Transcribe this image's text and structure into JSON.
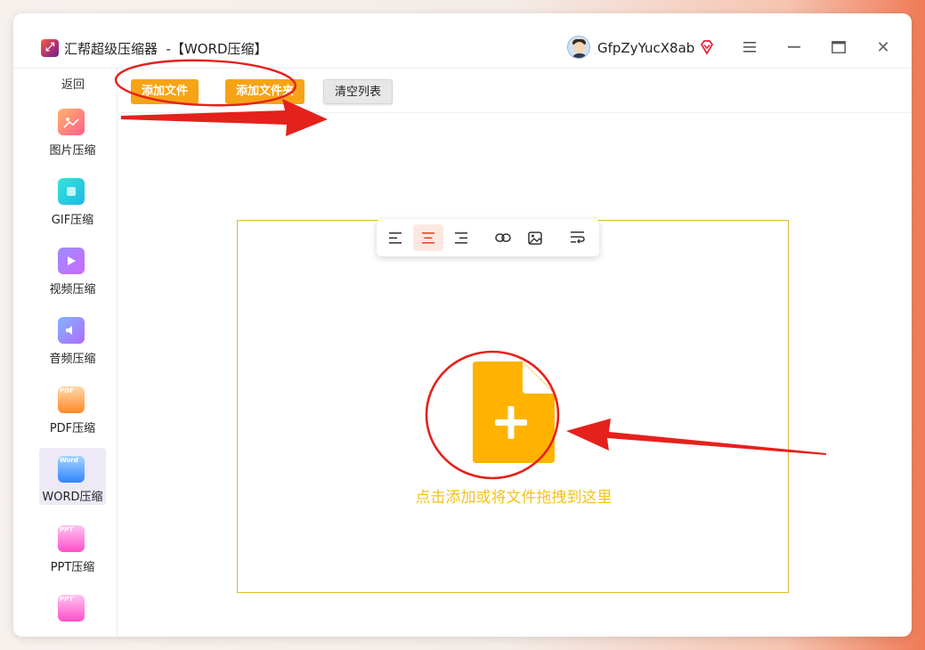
{
  "window": {
    "app_title": "汇帮超级压缩器  -【WORD压缩】",
    "username": "GfpZyYucX8ab"
  },
  "sidebar": {
    "back_label": "返回",
    "items": [
      {
        "label": "图片压缩",
        "icon": "image-icon"
      },
      {
        "label": "GIF压缩",
        "icon": "gif-icon"
      },
      {
        "label": "视频压缩",
        "icon": "video-icon"
      },
      {
        "label": "音频压缩",
        "icon": "audio-icon"
      },
      {
        "label": "PDF压缩",
        "icon": "pdf-icon",
        "badge": "PDF"
      },
      {
        "label": "WORD压缩",
        "icon": "word-icon",
        "badge": "Word",
        "active": true
      },
      {
        "label": "PPT压缩",
        "icon": "ppt-icon",
        "badge": "PPT"
      },
      {
        "label": "",
        "icon": "ppt-icon",
        "badge": "PPT"
      }
    ]
  },
  "toolbar": {
    "add_file_label": "添加文件",
    "add_folder_label": "添加文件夹",
    "clear_list_label": "清空列表"
  },
  "dropzone": {
    "text": "点击添加或将文件拖拽到这里"
  },
  "colors": {
    "accent_orange": "#f7a316",
    "drop_border": "#e1b82c",
    "drop_text": "#f4c21a",
    "file_icon": "#ffb300",
    "annotation_red": "#e5211c",
    "active_nav_bg": "#ede9f7"
  }
}
